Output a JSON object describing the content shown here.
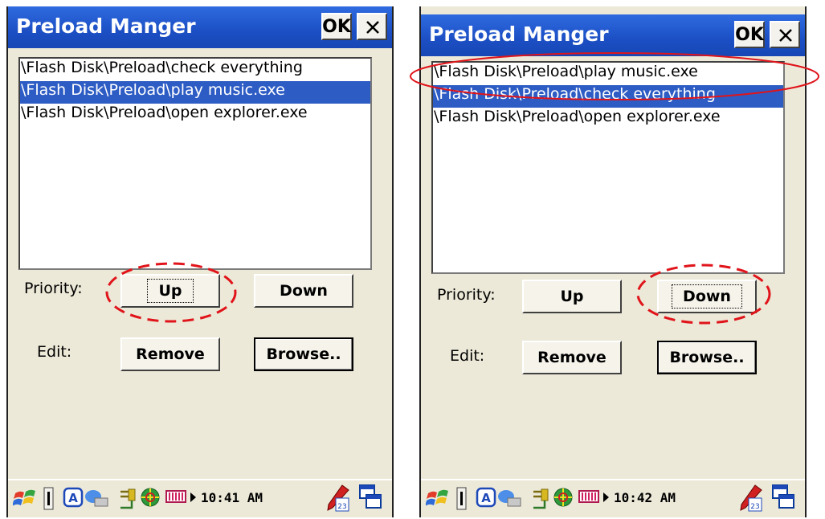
{
  "screens": [
    {
      "title": "Preload Manger",
      "ok_label": "OK",
      "items": [
        {
          "label": "\\Flash Disk\\Preload\\check everything",
          "selected": false
        },
        {
          "label": "\\Flash Disk\\Preload\\play music.exe",
          "selected": true
        },
        {
          "label": "\\Flash Disk\\Preload\\open explorer.exe",
          "selected": false
        }
      ],
      "priority_label": "Priority:",
      "up_label": "Up",
      "down_label": "Down",
      "edit_label": "Edit:",
      "remove_label": "Remove",
      "browse_label": "Browse..",
      "clock": "10:41 AM"
    },
    {
      "title": "Preload Manger",
      "ok_label": "OK",
      "items": [
        {
          "label": "\\Flash Disk\\Preload\\play music.exe",
          "selected": false
        },
        {
          "label": "\\Flash Disk\\Preload\\check everything",
          "selected": true
        },
        {
          "label": "\\Flash Disk\\Preload\\open explorer.exe",
          "selected": false
        }
      ],
      "priority_label": "Priority:",
      "up_label": "Up",
      "down_label": "Down",
      "edit_label": "Edit:",
      "remove_label": "Remove",
      "browse_label": "Browse..",
      "clock": "10:42 AM"
    }
  ],
  "annotation_color": "#e0141a",
  "selection_color": "#2d5cc4",
  "icons": [
    "start-flag-icon",
    "input-panel-icon",
    "keyboard-a-icon",
    "network-icon",
    "usb-plug-icon",
    "globe-icon",
    "battery-icon",
    "arrow-icon",
    "pen-tablet-icon",
    "window-switch-icon"
  ]
}
